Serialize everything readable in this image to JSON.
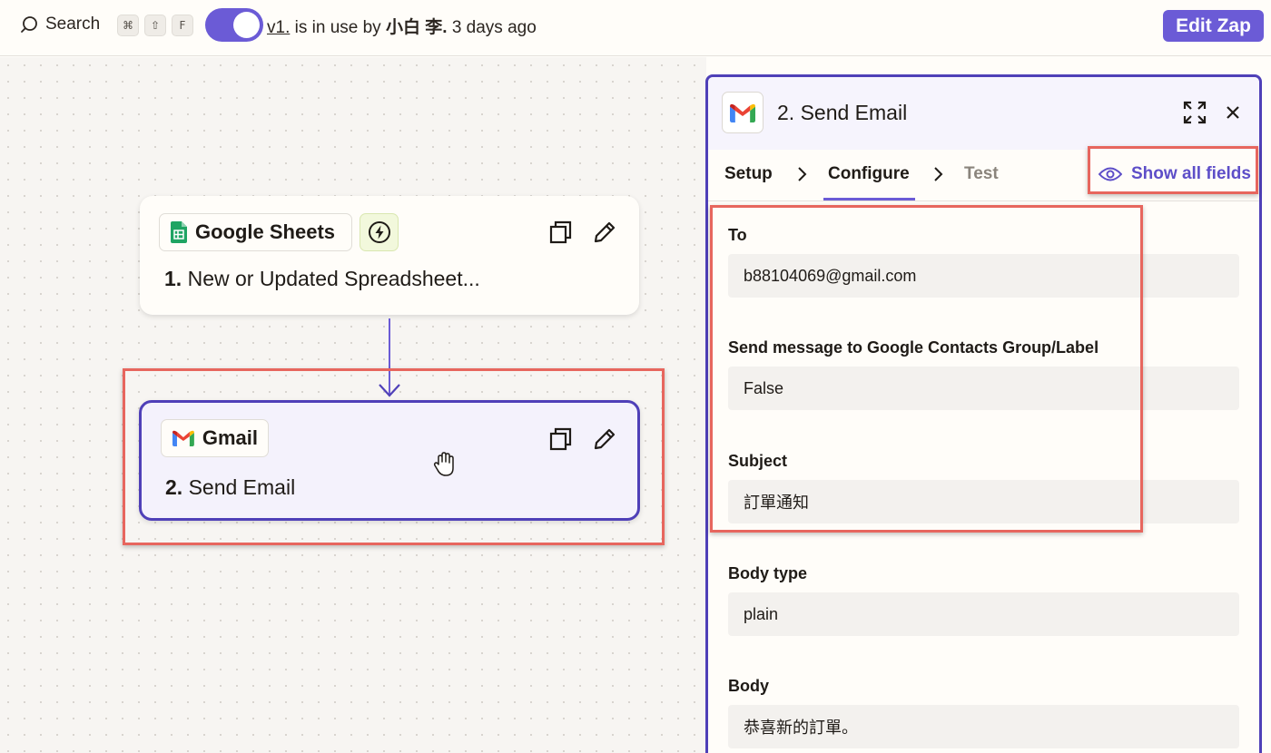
{
  "topbar": {
    "search_label": "Search",
    "shortcut_keys": [
      "⌘",
      "⇧",
      "F"
    ],
    "version_link": "v1.",
    "version_text": "is in use by",
    "version_user": "小白 李.",
    "version_time": "3 days ago",
    "edit_button": "Edit Zap"
  },
  "canvas": {
    "steps": [
      {
        "app": "Google Sheets",
        "number": "1.",
        "title": "New or Updated Spreadsheet..."
      },
      {
        "app": "Gmail",
        "number": "2.",
        "title": "Send Email"
      }
    ]
  },
  "panel": {
    "title": "2. Send Email",
    "tabs": [
      "Setup",
      "Configure",
      "Test"
    ],
    "active_tab": "Configure",
    "show_all_fields": "Show all fields",
    "fields": [
      {
        "label": "To",
        "value": "b88104069@gmail.com"
      },
      {
        "label": "Send message to Google Contacts Group/Label",
        "value": "False"
      },
      {
        "label": "Subject",
        "value": "訂單通知"
      },
      {
        "label": "Body type",
        "value": "plain"
      },
      {
        "label": "Body",
        "value": "恭喜新的訂單。"
      }
    ]
  },
  "colors": {
    "accent": "#6b5bd6",
    "selected_border": "#4f40b8",
    "highlight": "#e7665e"
  },
  "icons": [
    "search-icon",
    "google-sheets-icon",
    "bolt-icon",
    "duplicate-icon",
    "pencil-icon",
    "gmail-icon",
    "expand-icon",
    "close-icon",
    "chevron-right-icon",
    "eye-icon",
    "hand-cursor-icon"
  ]
}
